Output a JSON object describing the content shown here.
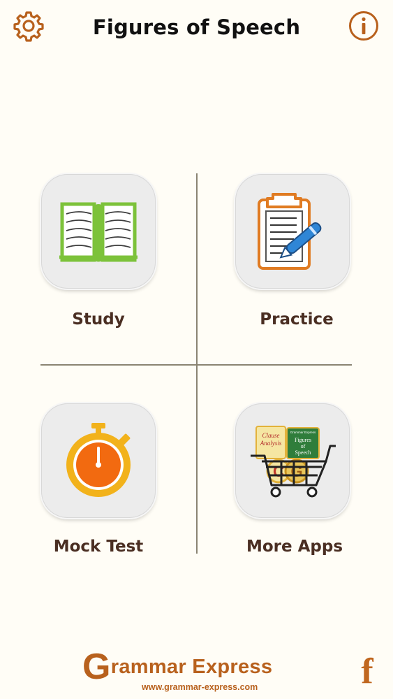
{
  "header": {
    "title": "Figures of Speech",
    "settings_icon": "gear-icon",
    "info_icon": "info-icon"
  },
  "menu": {
    "study": {
      "label": "Study",
      "icon": "open-book-icon"
    },
    "practice": {
      "label": "Practice",
      "icon": "clipboard-pen-icon"
    },
    "mock_test": {
      "label": "Mock Test",
      "icon": "stopwatch-icon"
    },
    "more_apps": {
      "label": "More Apps",
      "icon": "shopping-cart-apps-icon",
      "app_tile_texts": [
        "Clause Analysis",
        "Grammar Express",
        "Figures of Speech"
      ]
    }
  },
  "footer": {
    "brand_initial": "G",
    "brand_rest": "rammar Express",
    "url": "www.grammar-express.com",
    "facebook_icon": "facebook-icon",
    "facebook_glyph": "f"
  },
  "colors": {
    "accent": "#b8611d",
    "label": "#4a2e22",
    "divider": "#8a8472",
    "background": "#fffdf6"
  }
}
